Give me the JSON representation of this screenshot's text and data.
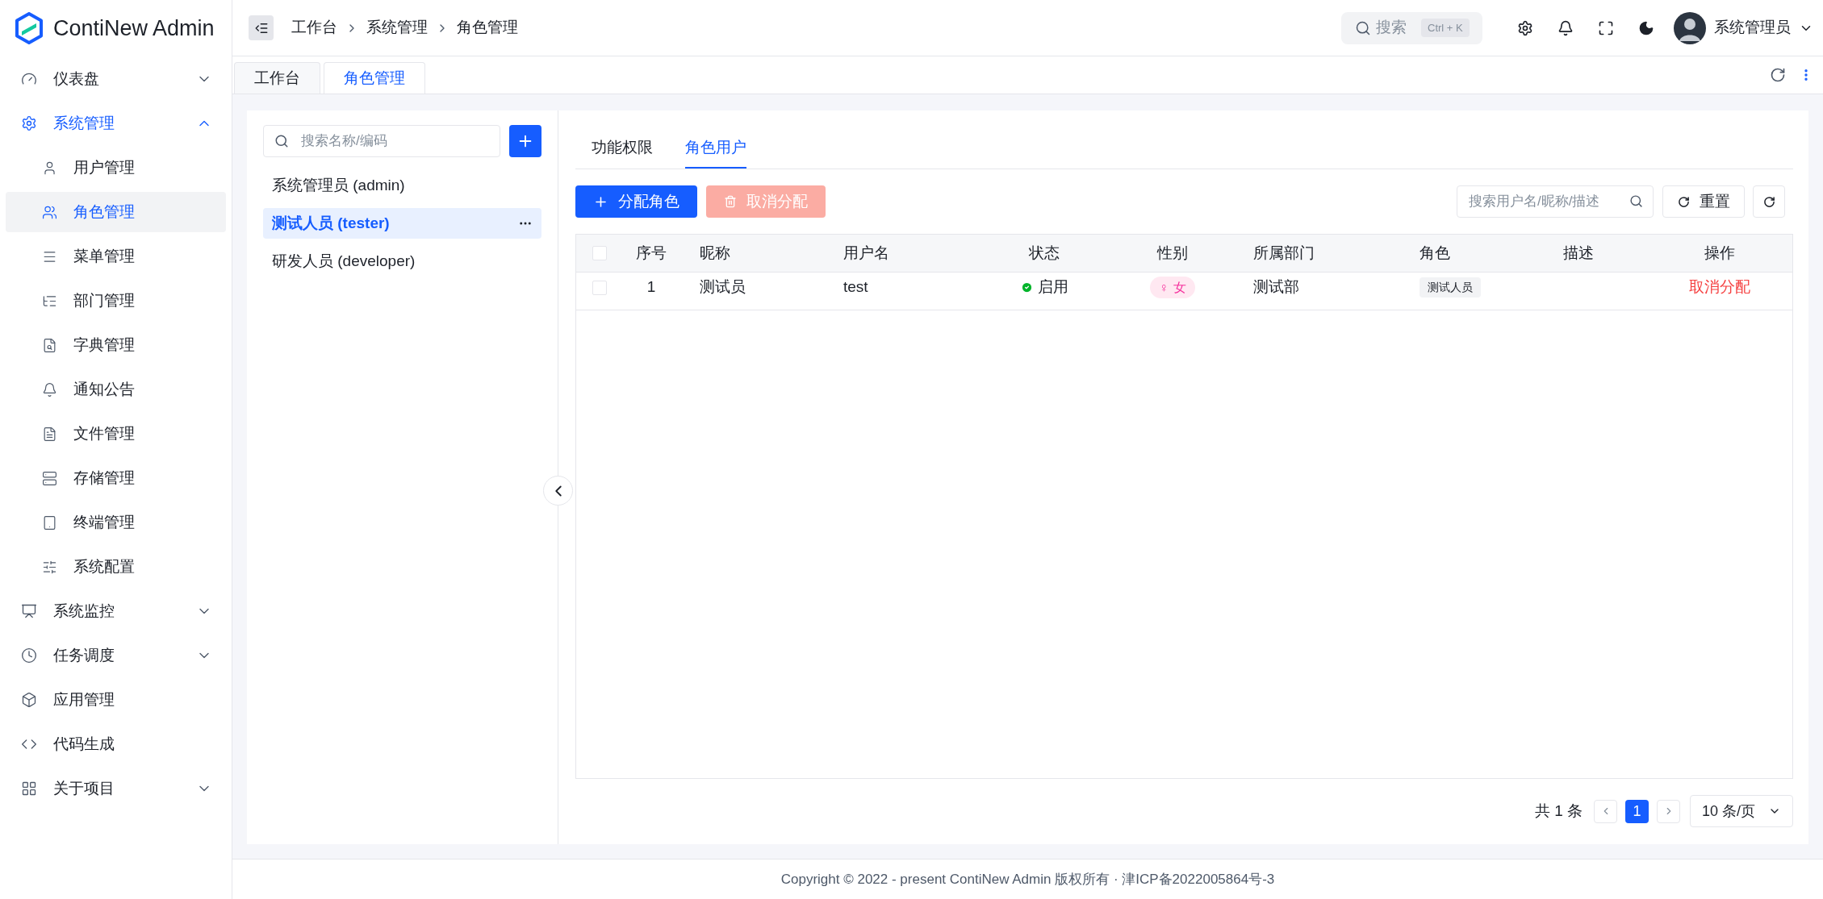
{
  "app": {
    "name": "ContiNew Admin"
  },
  "sidebar": {
    "items": [
      {
        "label": "仪表盘",
        "kind": "group",
        "expanded": false,
        "selected": false
      },
      {
        "label": "系统管理",
        "kind": "group",
        "expanded": true,
        "selected": false,
        "children": [
          {
            "label": "用户管理",
            "selected": false
          },
          {
            "label": "角色管理",
            "selected": true
          },
          {
            "label": "菜单管理",
            "selected": false
          },
          {
            "label": "部门管理",
            "selected": false
          },
          {
            "label": "字典管理",
            "selected": false
          },
          {
            "label": "通知公告",
            "selected": false
          },
          {
            "label": "文件管理",
            "selected": false
          },
          {
            "label": "存储管理",
            "selected": false
          },
          {
            "label": "终端管理",
            "selected": false
          },
          {
            "label": "系统配置",
            "selected": false
          }
        ]
      },
      {
        "label": "系统监控",
        "kind": "group",
        "expanded": false,
        "selected": false
      },
      {
        "label": "任务调度",
        "kind": "group",
        "expanded": false,
        "selected": false
      },
      {
        "label": "应用管理",
        "kind": "link",
        "selected": false
      },
      {
        "label": "代码生成",
        "kind": "link",
        "selected": false
      },
      {
        "label": "关于项目",
        "kind": "group",
        "expanded": false,
        "selected": false
      }
    ]
  },
  "header": {
    "breadcrumb": [
      "工作台",
      "系统管理",
      "角色管理"
    ],
    "search_button": {
      "label": "搜索",
      "shortcut": "Ctrl + K"
    },
    "user": {
      "name": "系统管理员"
    }
  },
  "page_tabs": [
    {
      "label": "工作台",
      "selected": false
    },
    {
      "label": "角色管理",
      "selected": true
    }
  ],
  "roles_panel": {
    "search": {
      "placeholder": "搜索名称/编码"
    },
    "roles": [
      {
        "label": "系统管理员 (admin)",
        "selected": false
      },
      {
        "label": "测试人员 (tester)",
        "selected": true
      },
      {
        "label": "研发人员 (developer)",
        "selected": false
      }
    ]
  },
  "detail": {
    "tabs": [
      {
        "label": "功能权限",
        "selected": false
      },
      {
        "label": "角色用户",
        "selected": true
      }
    ],
    "buttons": [
      {
        "label": "分配角色",
        "kind": "primary",
        "disabled": false
      },
      {
        "label": "取消分配",
        "kind": "danger",
        "disabled": true
      }
    ],
    "search": {
      "placeholder": "搜索用户名/昵称/描述"
    },
    "reset_button": "重置",
    "table": {
      "all_checked": false,
      "columns": [
        "序号",
        "昵称",
        "用户名",
        "状态",
        "性别",
        "所属部门",
        "角色",
        "描述",
        "操作"
      ],
      "rows": [
        {
          "checked": false,
          "index": "1",
          "nickname": "测试员",
          "username": "test",
          "status": {
            "label": "启用",
            "enabled": true
          },
          "gender": {
            "symbol": "♀",
            "label": "女"
          },
          "dept": "测试部",
          "role": "测试人员",
          "action": "取消分配"
        }
      ]
    },
    "pagination": {
      "total": "共 1 条",
      "pages": [
        {
          "label": "1",
          "selected": true
        }
      ],
      "page_size": "10 条/页"
    }
  },
  "footer": "Copyright © 2022 - present ContiNew Admin 版权所有 · 津ICP备2022005864号-3"
}
